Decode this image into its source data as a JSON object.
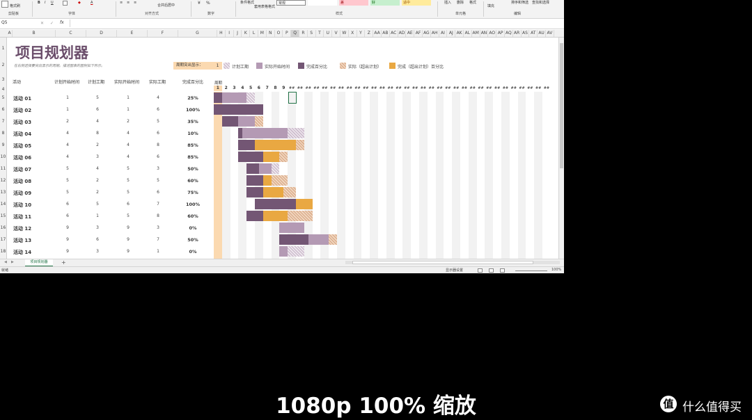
{
  "ribbon": {
    "format_painter": "格式刷",
    "groups": [
      "剪贴板",
      "字体",
      "对齐方式",
      "数字",
      "样式",
      "单元格",
      "编辑"
    ],
    "merge_center": "合并后居中",
    "conditional_format": "条件格式",
    "table_format": "套用表格格式",
    "insert": "插入",
    "delete": "删除",
    "format": "格式",
    "fill": "填充",
    "sort_filter": "排序和筛选",
    "find_select": "查找和选择",
    "style_normal": "常规",
    "style_bad": "差",
    "style_good": "好",
    "style_neutral": "适中",
    "percent": "%"
  },
  "formula_bar": {
    "name_box": "Q5",
    "fx": "fx",
    "formula": ""
  },
  "columns": [
    "A",
    "B",
    "C",
    "D",
    "E",
    "F",
    "G",
    "H",
    "I",
    "J",
    "K",
    "L",
    "M",
    "N",
    "O",
    "P",
    "Q",
    "R",
    "S",
    "T",
    "U",
    "V",
    "W",
    "X",
    "Y",
    "Z",
    "AA",
    "AB",
    "AC",
    "AD",
    "AE",
    "AF",
    "AG",
    "AH",
    "AI",
    "AJ",
    "AK",
    "AL",
    "AM",
    "AN",
    "AO",
    "AP",
    "AQ",
    "AR",
    "AS",
    "AT",
    "AU",
    "AV"
  ],
  "rows": [
    "1",
    "2",
    "3",
    "4",
    "5",
    "6",
    "7",
    "8",
    "9",
    "10",
    "11",
    "12",
    "13",
    "14",
    "15",
    "16",
    "17",
    "18"
  ],
  "sheet": {
    "title": "项目规划器",
    "subtitle": "在右侧选择要突出显示的周期。描述图表的图例如下所示。",
    "highlight_label": "周期突出显示：",
    "highlight_value": "1",
    "legend": [
      {
        "label": "计划工期",
        "style": "plan"
      },
      {
        "label": "实际开始时间",
        "style": "actual"
      },
      {
        "label": "完成百分比",
        "style": "done"
      },
      {
        "label": "实际（超出计划）",
        "style": "beyond"
      },
      {
        "label": "完成（超出计划）百分比",
        "style": "donebeyond"
      }
    ],
    "headers": {
      "activity": "活动",
      "plan_start": "计划开始时间",
      "plan_duration": "计划工期",
      "actual_start": "实际开始时间",
      "actual_duration": "实际工期",
      "percent_complete": "完成百分比"
    },
    "period_label": "周期",
    "period_numbers": [
      "1",
      "2",
      "3",
      "4",
      "5",
      "6",
      "7",
      "8",
      "9"
    ],
    "overflow_marker": "##",
    "activities": [
      {
        "name": "活动 01",
        "plan_start": 1,
        "plan_duration": 5,
        "actual_start": 1,
        "actual_duration": 4,
        "pct": "25%",
        "pct_value": 0.25
      },
      {
        "name": "活动 02",
        "plan_start": 1,
        "plan_duration": 6,
        "actual_start": 1,
        "actual_duration": 6,
        "pct": "100%",
        "pct_value": 1.0
      },
      {
        "name": "活动 03",
        "plan_start": 2,
        "plan_duration": 4,
        "actual_start": 2,
        "actual_duration": 5,
        "pct": "35%",
        "pct_value": 0.35
      },
      {
        "name": "活动 04",
        "plan_start": 4,
        "plan_duration": 8,
        "actual_start": 4,
        "actual_duration": 6,
        "pct": "10%",
        "pct_value": 0.1
      },
      {
        "name": "活动 05",
        "plan_start": 4,
        "plan_duration": 2,
        "actual_start": 4,
        "actual_duration": 8,
        "pct": "85%",
        "pct_value": 0.85
      },
      {
        "name": "活动 06",
        "plan_start": 4,
        "plan_duration": 3,
        "actual_start": 4,
        "actual_duration": 6,
        "pct": "85%",
        "pct_value": 0.85
      },
      {
        "name": "活动 07",
        "plan_start": 5,
        "plan_duration": 4,
        "actual_start": 5,
        "actual_duration": 3,
        "pct": "50%",
        "pct_value": 0.5
      },
      {
        "name": "活动 08",
        "plan_start": 5,
        "plan_duration": 2,
        "actual_start": 5,
        "actual_duration": 5,
        "pct": "60%",
        "pct_value": 0.6
      },
      {
        "name": "活动 09",
        "plan_start": 5,
        "plan_duration": 2,
        "actual_start": 5,
        "actual_duration": 6,
        "pct": "75%",
        "pct_value": 0.75
      },
      {
        "name": "活动 10",
        "plan_start": 6,
        "plan_duration": 5,
        "actual_start": 6,
        "actual_duration": 7,
        "pct": "100%",
        "pct_value": 1.0
      },
      {
        "name": "活动 11",
        "plan_start": 6,
        "plan_duration": 1,
        "actual_start": 5,
        "actual_duration": 8,
        "pct": "60%",
        "pct_value": 0.6
      },
      {
        "name": "活动 12",
        "plan_start": 9,
        "plan_duration": 3,
        "actual_start": 9,
        "actual_duration": 3,
        "pct": "0%",
        "pct_value": 0.0
      },
      {
        "name": "活动 13",
        "plan_start": 9,
        "plan_duration": 6,
        "actual_start": 9,
        "actual_duration": 7,
        "pct": "50%",
        "pct_value": 0.5
      },
      {
        "name": "活动 14",
        "plan_start": 9,
        "plan_duration": 3,
        "actual_start": 9,
        "actual_duration": 1,
        "pct": "0%",
        "pct_value": 0.0
      }
    ]
  },
  "colors": {
    "title": "#6b4e6b",
    "done": "#735674",
    "actual": "#b49ab4",
    "donebeyond": "#e9a842",
    "highlight_column": "#fbd9b0",
    "excel_green": "#217346"
  },
  "tabs": {
    "sheet_name": "项目规划器",
    "add_icon": "+"
  },
  "status": {
    "ready": "就绪",
    "display_settings": "显示器设置",
    "zoom": "100%"
  },
  "caption": "1080p 100% 缩放",
  "watermark": {
    "icon": "值",
    "text": "什么值得买"
  }
}
